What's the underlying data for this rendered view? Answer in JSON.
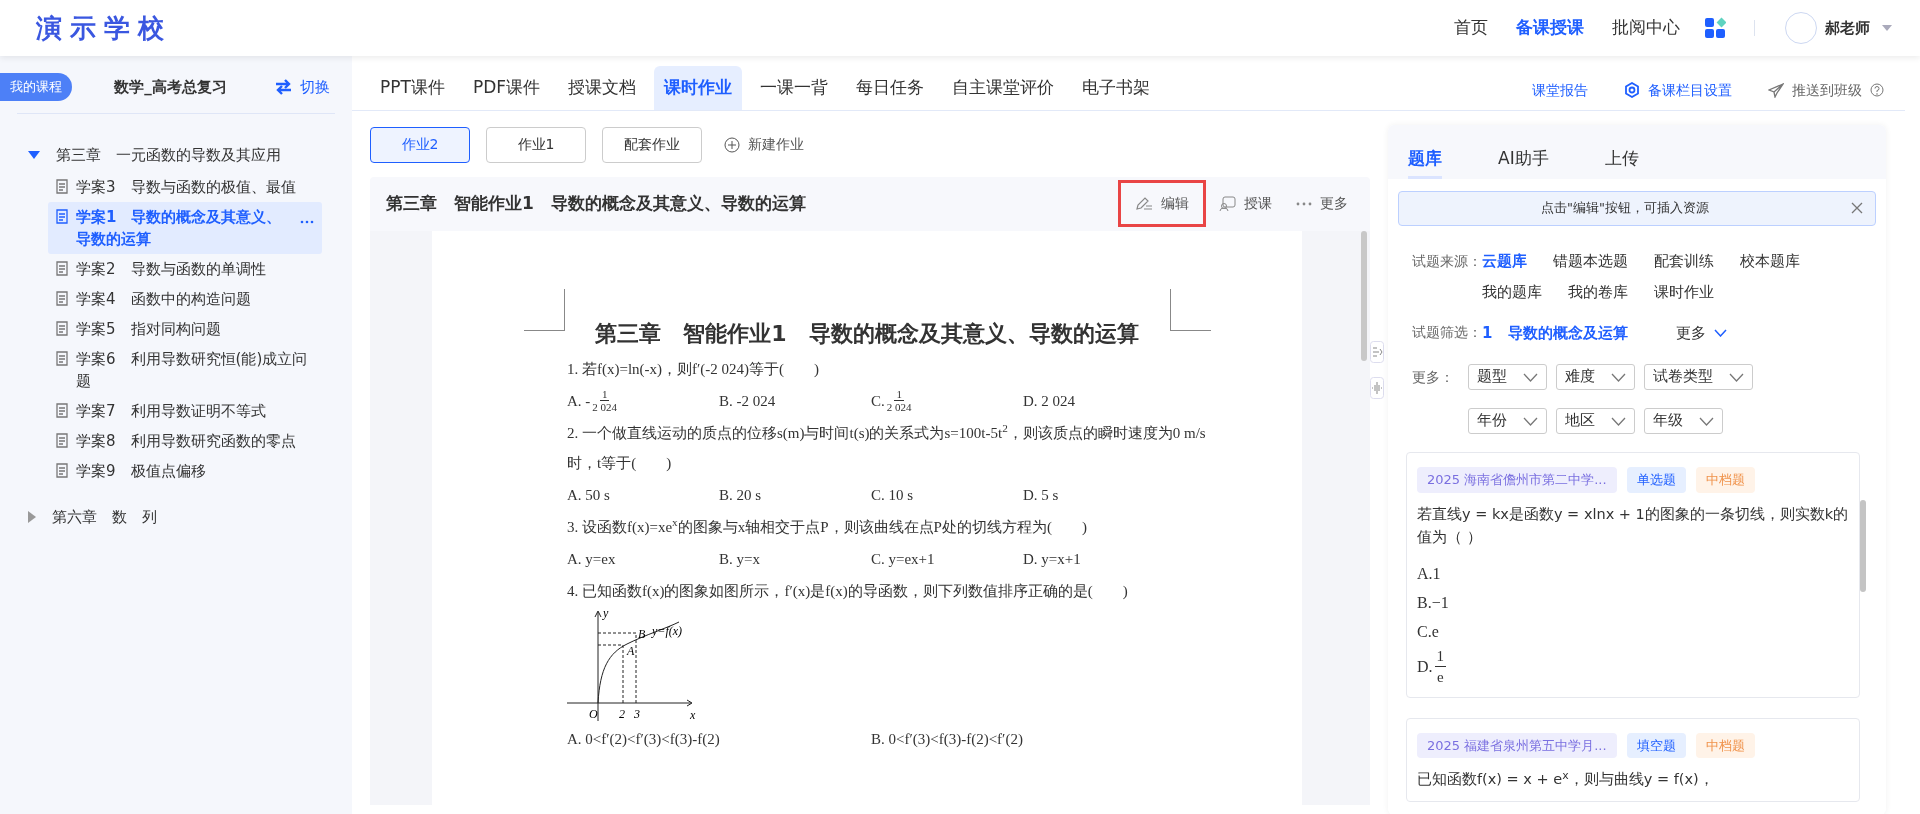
{
  "header": {
    "logo": "演示学校",
    "nav": [
      {
        "label": "首页",
        "selected": false
      },
      {
        "label": "备课授课",
        "selected": true
      },
      {
        "label": "批阅中心",
        "selected": false
      }
    ],
    "user": "郝老师"
  },
  "sidebar": {
    "badge": "我的课程",
    "course": "数学_高考总复习",
    "switch": "切换",
    "chapters": [
      {
        "label": "第三章　一元函数的导数及其应用",
        "expanded": true,
        "children": [
          {
            "label": "学案3　导数与函数的极值、最值",
            "selected": false
          },
          {
            "label": "学案1　导数的概念及其意义、导数的运算",
            "selected": true
          },
          {
            "label": "学案2　导数与函数的单调性",
            "selected": false
          },
          {
            "label": "学案4　函数中的构造问题",
            "selected": false
          },
          {
            "label": "学案5　指对同构问题",
            "selected": false
          },
          {
            "label": "学案6　利用导数研究恒(能)成立问题",
            "selected": false
          },
          {
            "label": "学案7　利用导数证明不等式",
            "selected": false
          },
          {
            "label": "学案8　利用导数研究函数的零点",
            "selected": false
          },
          {
            "label": "学案9　极值点偏移",
            "selected": false
          }
        ]
      },
      {
        "label": "第六章　数　列",
        "expanded": false
      }
    ]
  },
  "tabs": [
    {
      "label": "PPT课件",
      "selected": false
    },
    {
      "label": "PDF课件",
      "selected": false
    },
    {
      "label": "授课文档",
      "selected": false
    },
    {
      "label": "课时作业",
      "selected": true
    },
    {
      "label": "一课一背",
      "selected": false
    },
    {
      "label": "每日任务",
      "selected": false
    },
    {
      "label": "自主课堂评价",
      "selected": false
    },
    {
      "label": "电子书架",
      "selected": false
    }
  ],
  "tab_links": [
    {
      "kind": "report",
      "label": "课堂报告"
    },
    {
      "kind": "settings",
      "label": "备课栏目设置"
    },
    {
      "kind": "push",
      "label": "推送到班级"
    }
  ],
  "assignments": [
    {
      "label": "作业2",
      "selected": true
    },
    {
      "label": "作业1",
      "selected": false
    },
    {
      "label": "配套作业",
      "selected": false
    }
  ],
  "new_assignment": "新建作业",
  "document": {
    "title": "第三章　智能作业1　导数的概念及其意义、导数的运算",
    "actions": [
      {
        "kind": "edit",
        "label": "编辑",
        "highlighted": true
      },
      {
        "kind": "teach",
        "label": "授课",
        "highlighted": false
      },
      {
        "kind": "more",
        "label": "更多",
        "highlighted": false
      }
    ],
    "page": {
      "title": "第三章　智能作业1　导数的概念及其意义、导数的运算",
      "questions": [
        {
          "stem": "1. 若f(x)=ln(-x)，则f′(-2 024)等于(　　)",
          "options": [
            {
              "kind": "fraction",
              "label": "A.",
              "sign": "-",
              "num": "1",
              "den": "2 024"
            },
            {
              "kind": "text",
              "label": "B.",
              "text": "-2 024"
            },
            {
              "kind": "fraction",
              "label": "C.",
              "num": "1",
              "den": "2 024"
            },
            {
              "kind": "text",
              "label": "D.",
              "text": "2 024"
            }
          ]
        },
        {
          "stem": "2. 一个做直线运动的质点的位移s(m)与时间t(s)的关系式为s=100t-5t$^{2}$，则该质点的瞬时速度为0 m/s时，t等于(　　)",
          "options": [
            {
              "kind": "text",
              "label": "A.",
              "text": "50 s"
            },
            {
              "kind": "text",
              "label": "B.",
              "text": "20 s"
            },
            {
              "kind": "text",
              "label": "C.",
              "text": "10 s"
            },
            {
              "kind": "text",
              "label": "D.",
              "text": "5 s"
            }
          ]
        },
        {
          "stem": "3. 设函数f(x)=xe$^{x}$的图象与x轴相交于点P，则该曲线在点P处的切线方程为(　　)",
          "options": [
            {
              "kind": "text",
              "label": "A.",
              "text": "y=ex"
            },
            {
              "kind": "text",
              "label": "B.",
              "text": "y=x"
            },
            {
              "kind": "text",
              "label": "C.",
              "text": "y=ex+1"
            },
            {
              "kind": "text",
              "label": "D.",
              "text": "y=x+1"
            }
          ]
        },
        {
          "stem": "4. 已知函数f(x)的图象如图所示，f′(x)是f(x)的导函数，则下列数值排序正确的是(　　)",
          "figure": {
            "axis_x": "x",
            "axis_y": "y",
            "origin": "O",
            "ticks": [
              "2",
              "3"
            ],
            "points": [
              "A",
              "B"
            ],
            "curve_label": "y=f(x)"
          },
          "options": [
            {
              "kind": "text",
              "label": "A.",
              "text": "0<f′(2)<f′(3)<f(3)-f(2)"
            },
            {
              "kind": "text",
              "label": "B.",
              "text": "0<f′(3)<f(3)-f(2)<f′(2)"
            }
          ]
        }
      ]
    }
  },
  "panel": {
    "tabs": [
      {
        "label": "题库",
        "selected": true
      },
      {
        "label": "AI助手",
        "selected": false
      },
      {
        "label": "上传",
        "selected": false
      }
    ],
    "notice": "点击\"编辑\"按钮，可插入资源",
    "source_label": "试题来源：",
    "sources": [
      {
        "label": "云题库",
        "selected": true
      },
      {
        "label": "错题本选题",
        "selected": false
      },
      {
        "label": "配套训练",
        "selected": false
      },
      {
        "label": "校本题库",
        "selected": false
      },
      {
        "label": "我的题库",
        "selected": false
      },
      {
        "label": "我的卷库",
        "selected": false
      },
      {
        "label": "课时作业",
        "selected": false
      }
    ],
    "filter_label": "试题筛选：",
    "filter_index": "1",
    "filter_topic": "导数的概念及运算",
    "filter_more": "更多",
    "more_label": "更多：",
    "selects": [
      {
        "label": "题型"
      },
      {
        "label": "难度"
      },
      {
        "label": "试卷类型"
      },
      {
        "label": "年份"
      },
      {
        "label": "地区"
      },
      {
        "label": "年级"
      }
    ],
    "cards": [
      {
        "tags": [
          {
            "kind": "source",
            "label": "2025 海南省儋州市第二中学..."
          },
          {
            "kind": "type",
            "label": "单选题"
          },
          {
            "kind": "level",
            "label": "中档题"
          }
        ],
        "stem": "若直线y = kx是函数y = xlnx + 1的图象的一条切线，则实数k的值为（  ）",
        "options": [
          {
            "kind": "text",
            "label": "A.",
            "text": "1"
          },
          {
            "kind": "text",
            "label": "B.",
            "text": "−1"
          },
          {
            "kind": "text",
            "label": "C.",
            "text": "e"
          },
          {
            "kind": "fraction",
            "label": "D.",
            "num": "1",
            "den": "e"
          }
        ]
      },
      {
        "tags": [
          {
            "kind": "source",
            "label": "2025 福建省泉州第五中学月..."
          },
          {
            "kind": "type",
            "label": "填空题"
          },
          {
            "kind": "level",
            "label": "中档题"
          }
        ],
        "stem": "已知函数f(x) = x + e$^{x}$，则与曲线y = f(x)，"
      }
    ]
  }
}
